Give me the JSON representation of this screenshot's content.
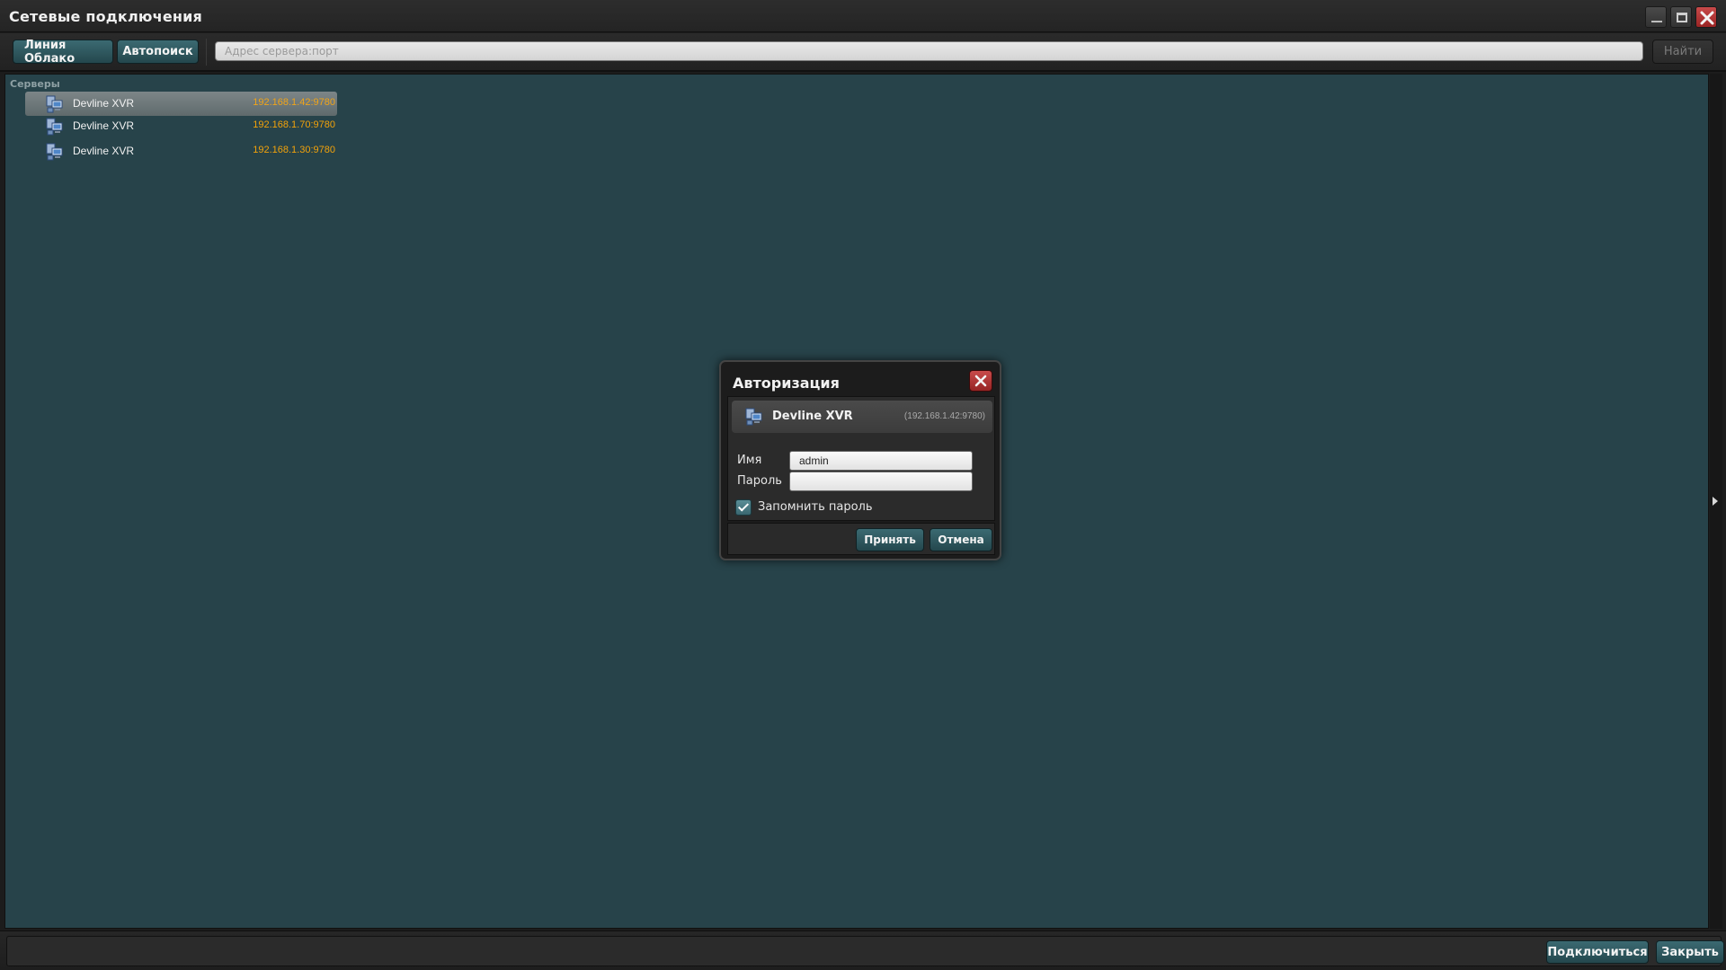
{
  "window": {
    "title": "Сетевые подключения"
  },
  "toolbar": {
    "cloud_label": "Линия Облако",
    "autosearch_label": "Автопоиск",
    "address_placeholder": "Адрес сервера:порт",
    "find_label": "Найти"
  },
  "servers": {
    "section_label": "Серверы",
    "items": [
      {
        "name": "Devline XVR",
        "address": "192.168.1.42:9780",
        "selected": true
      },
      {
        "name": "Devline XVR",
        "address": "192.168.1.70:9780",
        "selected": false
      },
      {
        "name": "Devline XVR",
        "address": "192.168.1.30:9780",
        "selected": false
      }
    ]
  },
  "footer": {
    "connect_label": "Подключиться",
    "close_label": "Закрыть"
  },
  "auth_dialog": {
    "title": "Авторизация",
    "server_name": "Devline XVR",
    "server_address": "(192.168.1.42:9780)",
    "name_label": "Имя",
    "name_value": "admin",
    "password_label": "Пароль",
    "password_value": "",
    "remember_label": "Запомнить пароль",
    "remember_checked": true,
    "accept_label": "Принять",
    "cancel_label": "Отмена"
  },
  "colors": {
    "panel_bg": "#27434a",
    "accent_button": "#2f5a61",
    "address_text": "#f2a20a",
    "close_red": "#b23636"
  },
  "icons": [
    "minimize-icon",
    "maximize-icon",
    "close-icon",
    "server-icon",
    "checkmark-icon",
    "scroll-arrow-icon"
  ]
}
